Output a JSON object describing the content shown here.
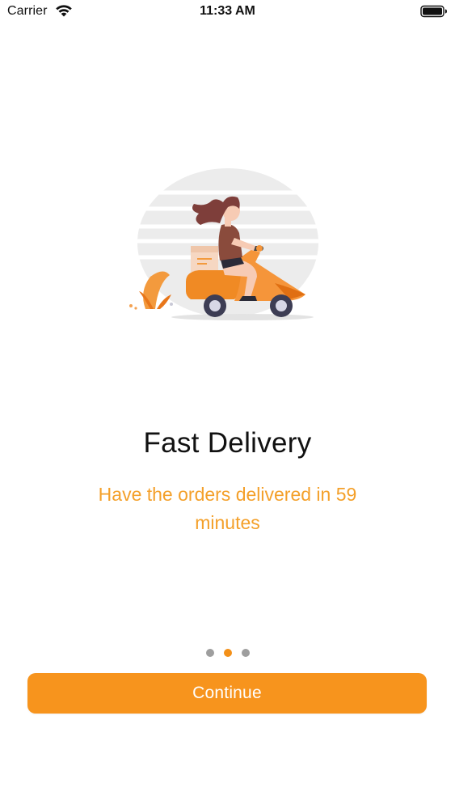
{
  "status_bar": {
    "carrier": "Carrier",
    "time": "11:33 AM",
    "icons": [
      "wifi-icon",
      "battery-icon"
    ]
  },
  "onboarding": {
    "illustration": "woman-riding-scooter-illustration",
    "title": "Fast Delivery",
    "subtitle": "Have the orders delivered in 59 minutes",
    "page_indicator": {
      "count": 3,
      "active_index": 1
    },
    "continue_label": "Continue"
  },
  "colors": {
    "accent": "#f7941d",
    "subtitle": "#f4a02a",
    "dot_inactive": "#9e9e9e",
    "title": "#111111"
  }
}
